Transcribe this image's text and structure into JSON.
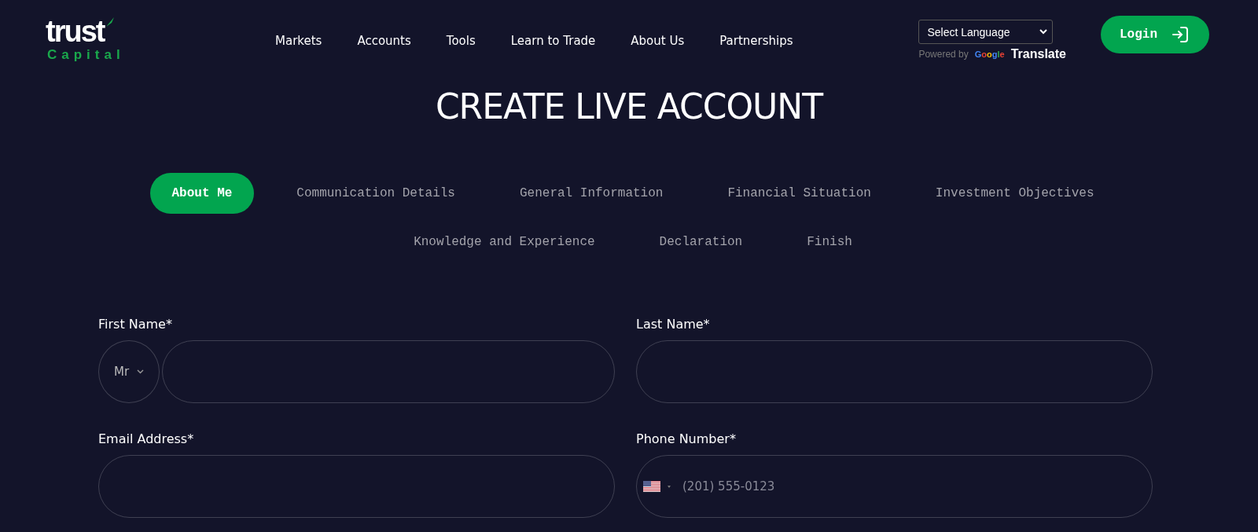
{
  "header": {
    "logo": {
      "word": "trust",
      "sub": "Capital"
    },
    "nav": [
      "Markets",
      "Accounts",
      "Tools",
      "Learn to Trade",
      "About Us",
      "Partnerships"
    ],
    "language": {
      "select": "Select Language",
      "powered_by": "Powered by",
      "google": "Google",
      "translate": "Translate"
    },
    "login": "Login"
  },
  "title": "CREATE LIVE ACCOUNT",
  "steps": [
    [
      {
        "label": "About Me",
        "selected": true
      },
      {
        "label": "Communication Details",
        "selected": false
      },
      {
        "label": "General Information",
        "selected": false
      },
      {
        "label": "Financial Situation",
        "selected": false
      },
      {
        "label": "Investment Objectives",
        "selected": false
      }
    ],
    [
      {
        "label": "Knowledge and Experience",
        "selected": false
      },
      {
        "label": "Declaration",
        "selected": false
      },
      {
        "label": "Finish",
        "selected": false
      }
    ]
  ],
  "fields": [
    {
      "label": "First Name*",
      "kind": "titled",
      "title": "Mr"
    },
    {
      "label": "Last Name*",
      "kind": "text"
    },
    {
      "label": "Email Address*",
      "kind": "text"
    },
    {
      "label": "Phone Number*",
      "kind": "phone",
      "placeholder": "(201) 555-0123"
    }
  ]
}
